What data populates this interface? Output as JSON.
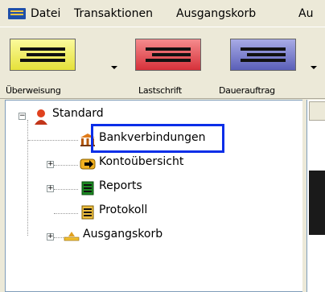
{
  "menu": {
    "items": [
      "Datei",
      "Transaktionen",
      "Ausgangskorb",
      "Au"
    ]
  },
  "toolbar": {
    "buttons": [
      {
        "label": "Überweisung",
        "color": "#f2ef59"
      },
      {
        "label": "Lastschrift",
        "color": "#e8474f"
      },
      {
        "label": "Dauerauftrag",
        "color": "#6f73c7"
      }
    ]
  },
  "tree": {
    "root": {
      "label": "Standard",
      "icon": "user-icon"
    },
    "children": [
      {
        "label": "Bankverbindungen",
        "icon": "bank-icon",
        "expandable": false
      },
      {
        "label": "Kontoübersicht",
        "icon": "transfer-arrow-icon",
        "expandable": true
      },
      {
        "label": "Reports",
        "icon": "report-icon",
        "expandable": true
      },
      {
        "label": "Protokoll",
        "icon": "log-icon",
        "expandable": false
      },
      {
        "label": "Ausgangskorb",
        "icon": "outbox-icon",
        "expandable": true
      }
    ]
  },
  "colors": {
    "highlight": "#0a2ee8",
    "window_bg": "#ece9d8"
  }
}
